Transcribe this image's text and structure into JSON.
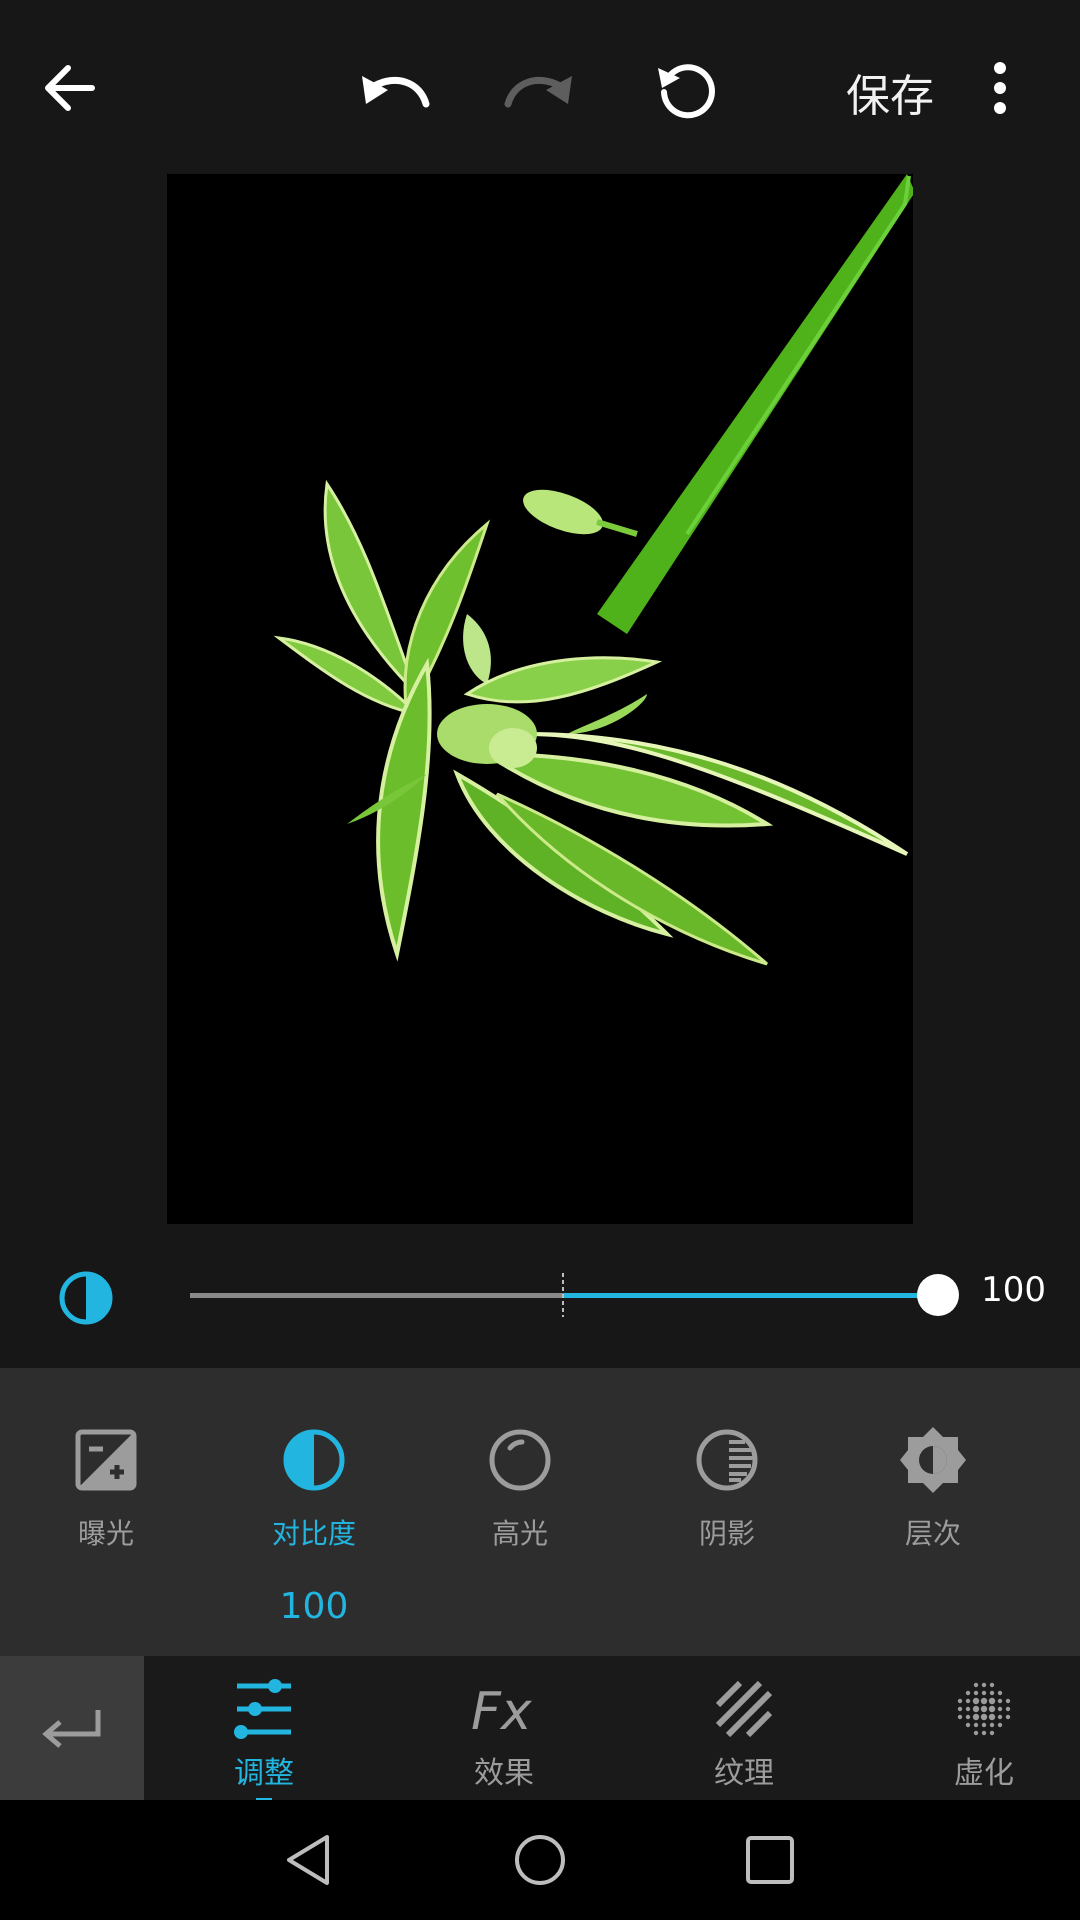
{
  "toolbar": {
    "save_label": "保存"
  },
  "colors": {
    "accent": "#22b5e0",
    "panel": "#2d2d2d",
    "background": "#171717"
  },
  "photo": {
    "subject_icon": "plant-photo"
  },
  "slider": {
    "icon": "contrast-icon",
    "value": "100",
    "level_fraction": 1.0
  },
  "tools": [
    {
      "label": "曝光",
      "icon": "exposure-icon"
    },
    {
      "label": "对比度",
      "icon": "contrast-icon",
      "active": true,
      "value": "100"
    },
    {
      "label": "高光",
      "icon": "highlight-icon"
    },
    {
      "label": "阴影",
      "icon": "shadow-icon"
    },
    {
      "label": "层次",
      "icon": "structure-icon"
    }
  ],
  "tabs": [
    {
      "label": "调整",
      "icon": "adjust-icon",
      "active": true
    },
    {
      "label": "效果",
      "icon": "fx-icon"
    },
    {
      "label": "纹理",
      "icon": "texture-icon"
    },
    {
      "label": "虚化",
      "icon": "blur-icon"
    }
  ]
}
